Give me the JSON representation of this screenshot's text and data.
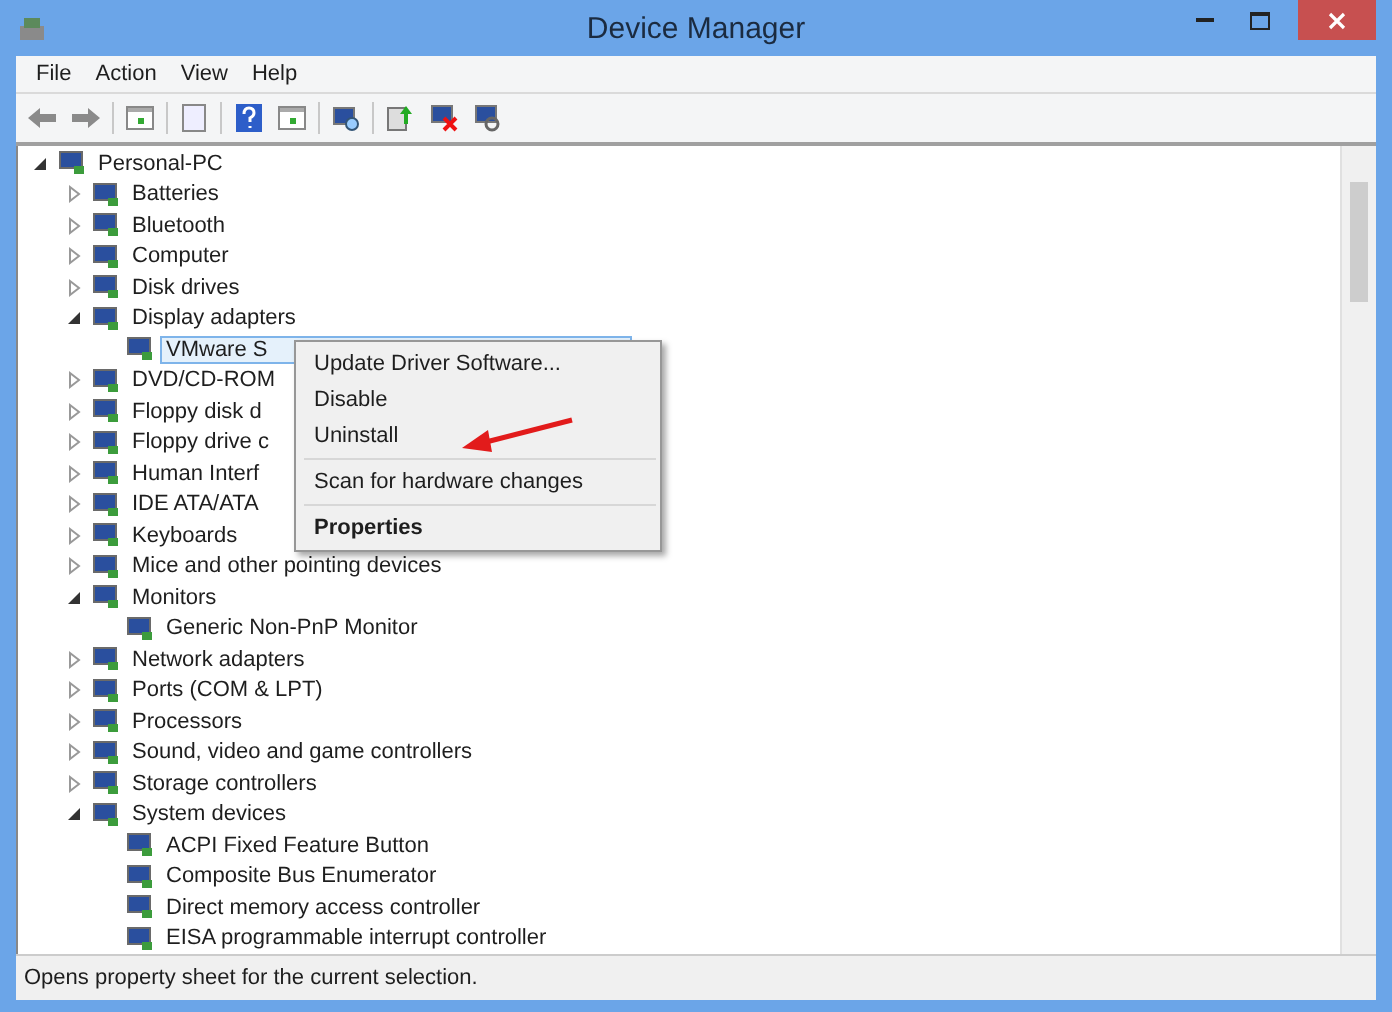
{
  "window": {
    "title": "Device Manager"
  },
  "menu_bar": [
    "File",
    "Action",
    "View",
    "Help"
  ],
  "tree": [
    {
      "label": "Personal-PC",
      "expanded": true,
      "selected": false,
      "children": [
        {
          "label": "Batteries",
          "expanded": false,
          "selected": false
        },
        {
          "label": "Bluetooth",
          "expanded": false,
          "selected": false
        },
        {
          "label": "Computer",
          "expanded": false,
          "selected": false
        },
        {
          "label": "Disk drives",
          "expanded": false,
          "selected": false
        },
        {
          "label": "Display adapters",
          "expanded": true,
          "selected": false,
          "children": [
            {
              "label": "VMware S",
              "selected": true
            }
          ]
        },
        {
          "label": "DVD/CD-ROM",
          "expanded": false,
          "selected": false
        },
        {
          "label": "Floppy disk d",
          "expanded": false,
          "selected": false
        },
        {
          "label": "Floppy drive c",
          "expanded": false,
          "selected": false
        },
        {
          "label": "Human Interf",
          "expanded": false,
          "selected": false
        },
        {
          "label": "IDE ATA/ATA",
          "expanded": false,
          "selected": false
        },
        {
          "label": "Keyboards",
          "expanded": false,
          "selected": false
        },
        {
          "label": "Mice and other pointing devices",
          "expanded": false,
          "selected": false
        },
        {
          "label": "Monitors",
          "expanded": true,
          "selected": false,
          "children": [
            {
              "label": "Generic Non-PnP Monitor",
              "selected": false
            }
          ]
        },
        {
          "label": "Network adapters",
          "expanded": false,
          "selected": false
        },
        {
          "label": "Ports (COM & LPT)",
          "expanded": false,
          "selected": false
        },
        {
          "label": "Processors",
          "expanded": false,
          "selected": false
        },
        {
          "label": "Sound, video and game controllers",
          "expanded": false,
          "selected": false
        },
        {
          "label": "Storage controllers",
          "expanded": false,
          "selected": false
        },
        {
          "label": "System devices",
          "expanded": true,
          "selected": false,
          "children": [
            {
              "label": "ACPI Fixed Feature Button",
              "selected": false
            },
            {
              "label": "Composite Bus Enumerator",
              "selected": false
            },
            {
              "label": "Direct memory access controller",
              "selected": false
            },
            {
              "label": "EISA programmable interrupt controller",
              "selected": false
            }
          ]
        }
      ]
    }
  ],
  "context_menu": {
    "groups": [
      {
        "items": [
          {
            "label": "Update Driver Software...",
            "default": false
          },
          {
            "label": "Disable",
            "default": false
          },
          {
            "label": "Uninstall",
            "default": false
          }
        ]
      },
      {
        "items": [
          {
            "label": "Scan for hardware changes",
            "default": false
          }
        ]
      },
      {
        "items": [
          {
            "label": "Properties",
            "default": true
          }
        ]
      }
    ]
  },
  "status_bar": "Opens property sheet for the current selection."
}
